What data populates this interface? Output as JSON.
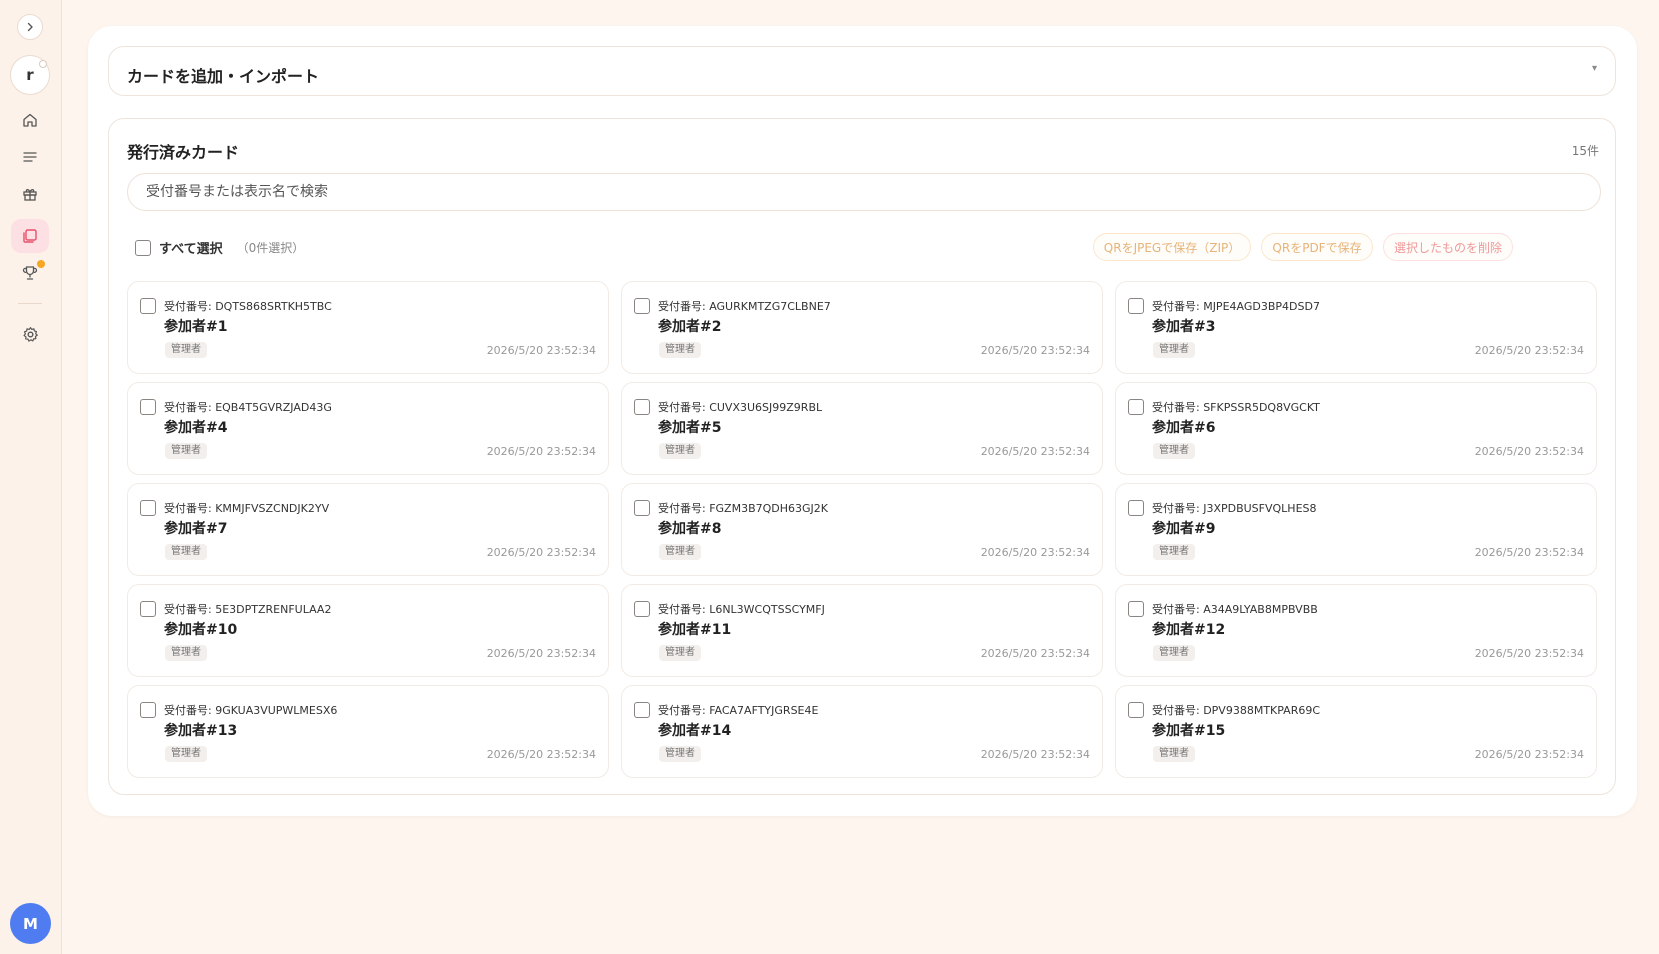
{
  "sidebar": {
    "workspace_initial": "r",
    "user_initial": "M",
    "items": [
      {
        "icon": "home-icon",
        "active": false
      },
      {
        "icon": "list-icon",
        "active": false
      },
      {
        "icon": "gift-icon",
        "active": false
      },
      {
        "icon": "cards-icon",
        "active": true
      },
      {
        "icon": "trophy-icon",
        "active": false,
        "badge": true
      },
      {
        "icon": "gear-icon",
        "active": false
      }
    ]
  },
  "add_section": {
    "title": "カードを追加・インポート",
    "caret": "▾"
  },
  "issued": {
    "title": "発行済みカード",
    "count": "15件",
    "search_placeholder": "受付番号または表示名で検索",
    "select_all_label": "すべて選択",
    "selected_count": "（0件選択）",
    "buttons": {
      "jpeg": "QRをJPEGで保存（ZIP）",
      "pdf": "QRをPDFで保存",
      "delete": "選択したものを削除"
    }
  },
  "cards": [
    {
      "code": "受付番号: DQTS868SRTKH5TBC",
      "name": "参加者#1",
      "role": "管理者",
      "time": "2026/5/20 23:52:34"
    },
    {
      "code": "受付番号: AGURKMTZG7CLBNE7",
      "name": "参加者#2",
      "role": "管理者",
      "time": "2026/5/20 23:52:34"
    },
    {
      "code": "受付番号: MJPE4AGD3BP4DSD7",
      "name": "参加者#3",
      "role": "管理者",
      "time": "2026/5/20 23:52:34"
    },
    {
      "code": "受付番号: EQB4T5GVRZJAD43G",
      "name": "参加者#4",
      "role": "管理者",
      "time": "2026/5/20 23:52:34"
    },
    {
      "code": "受付番号: CUVX3U6SJ99Z9RBL",
      "name": "参加者#5",
      "role": "管理者",
      "time": "2026/5/20 23:52:34"
    },
    {
      "code": "受付番号: SFKPSSR5DQ8VGCKT",
      "name": "参加者#6",
      "role": "管理者",
      "time": "2026/5/20 23:52:34"
    },
    {
      "code": "受付番号: KMMJFVSZCNDJK2YV",
      "name": "参加者#7",
      "role": "管理者",
      "time": "2026/5/20 23:52:34"
    },
    {
      "code": "受付番号: FGZM3B7QDH63GJ2K",
      "name": "参加者#8",
      "role": "管理者",
      "time": "2026/5/20 23:52:34"
    },
    {
      "code": "受付番号: J3XPDBUSFVQLHES8",
      "name": "参加者#9",
      "role": "管理者",
      "time": "2026/5/20 23:52:34"
    },
    {
      "code": "受付番号: 5E3DPTZRENFULAA2",
      "name": "参加者#10",
      "role": "管理者",
      "time": "2026/5/20 23:52:34"
    },
    {
      "code": "受付番号: L6NL3WCQTSSCYMFJ",
      "name": "参加者#11",
      "role": "管理者",
      "time": "2026/5/20 23:52:34"
    },
    {
      "code": "受付番号: A34A9LYAB8MPBVBB",
      "name": "参加者#12",
      "role": "管理者",
      "time": "2026/5/20 23:52:34"
    },
    {
      "code": "受付番号: 9GKUA3VUPWLMESX6",
      "name": "参加者#13",
      "role": "管理者",
      "time": "2026/5/20 23:52:34"
    },
    {
      "code": "受付番号: FACA7AFTYJGRSE4E",
      "name": "参加者#14",
      "role": "管理者",
      "time": "2026/5/20 23:52:34"
    },
    {
      "code": "受付番号: DPV9388MTKPAR69C",
      "name": "参加者#15",
      "role": "管理者",
      "time": "2026/5/20 23:52:34"
    }
  ]
}
